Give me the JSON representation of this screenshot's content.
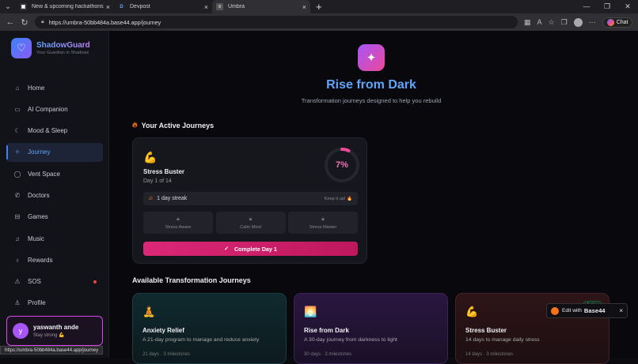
{
  "browser": {
    "tabs": [
      {
        "title": "New & upcoming hackathons - Ev",
        "icon": "devpost-icon"
      },
      {
        "title": "Devpost",
        "icon": "D"
      },
      {
        "title": "Umbra",
        "icon": "umbra-icon"
      }
    ],
    "url": "https://umbra-50bb484a.base44.app/journey",
    "chat_label": "Chat",
    "status_url": "https://umbra-50bb484a.base44.app/journey"
  },
  "app": {
    "name": "ShadowGuard",
    "tagline": "Your Guardian in Shadows",
    "menu": [
      {
        "label": "Home",
        "icon": "home-icon"
      },
      {
        "label": "AI Companion",
        "icon": "chat-icon"
      },
      {
        "label": "Mood & Sleep",
        "icon": "moon-icon"
      },
      {
        "label": "Journey",
        "icon": "sparkle-icon",
        "active": true
      },
      {
        "label": "Vent Space",
        "icon": "bubble-icon"
      },
      {
        "label": "Doctors",
        "icon": "phone-icon"
      },
      {
        "label": "Games",
        "icon": "gamepad-icon"
      },
      {
        "label": "Music",
        "icon": "music-icon"
      },
      {
        "label": "Rewards",
        "icon": "award-icon"
      },
      {
        "label": "SOS",
        "icon": "warning-icon",
        "alert": true
      },
      {
        "label": "Profile",
        "icon": "user-icon"
      }
    ],
    "user": {
      "initial": "y",
      "name": "yaswanth ande",
      "status": "Stay strong 💪"
    }
  },
  "hero": {
    "title": "Rise from Dark",
    "subtitle": "Transformation journeys designed to help you rebuild"
  },
  "active": {
    "heading": "Your Active Journeys",
    "card": {
      "emoji": "💪",
      "title": "Stress Buster",
      "day": "Day 1 of 14",
      "progress_label": "7%",
      "progress": 0.07,
      "streak": "1 day streak",
      "keep": "Keep it up! 🔥",
      "milestones": [
        "Stress Aware",
        "Calm Mind",
        "Stress Master"
      ],
      "button": "Complete Day 1"
    }
  },
  "available": {
    "heading": "Available Transformation Journeys",
    "cards": [
      {
        "emoji": "🧘",
        "title": "Anxiety Relief",
        "desc": "A 21-day program to manage and reduce anxiety",
        "footer": "21 days  ·  3 milestones",
        "badge": ""
      },
      {
        "emoji": "🌅",
        "title": "Rise from Dark",
        "desc": "A 30-day journey from darkness to light",
        "footer": "30 days  ·  3 milestones",
        "badge": ""
      },
      {
        "emoji": "💪",
        "title": "Stress Buster",
        "desc": "14 days to manage daily stress",
        "footer": "14 days  ·  3 milestones",
        "badge": "Active"
      }
    ]
  },
  "edit_badge": {
    "prefix": "Edit with",
    "brand": "Base44"
  },
  "colors": {
    "accent": "#60a5fa",
    "pink": "#db2777",
    "purple": "#a855f7"
  }
}
